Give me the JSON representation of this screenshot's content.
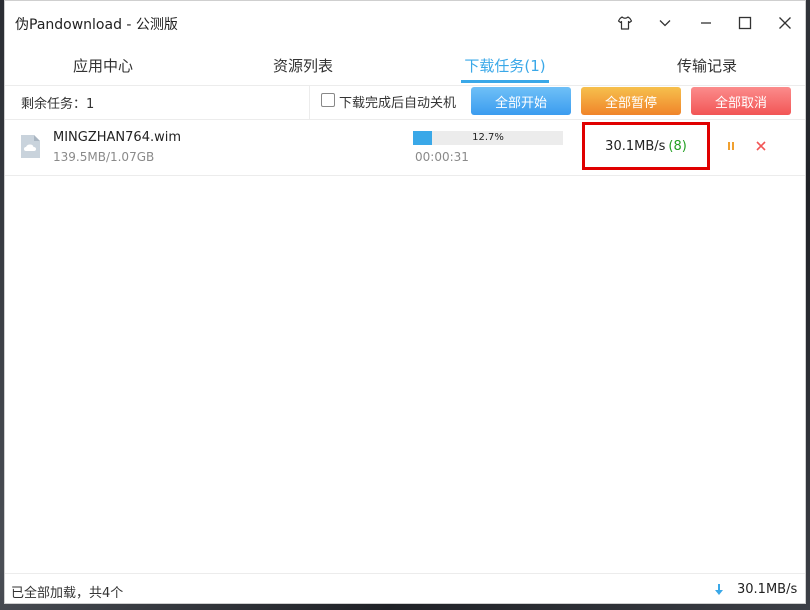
{
  "window": {
    "title": "伪Pandownload - 公测版"
  },
  "tabs": [
    {
      "label": "应用中心"
    },
    {
      "label": "资源列表"
    },
    {
      "label": "下载任务(1)"
    },
    {
      "label": "传输记录"
    }
  ],
  "toolbar": {
    "remaining": "剩余任务：1",
    "auto_shutdown_label": "下载完成后自动关机",
    "auto_shutdown_checked": false,
    "start_all": "全部开始",
    "pause_all": "全部暂停",
    "cancel_all": "全部取消"
  },
  "downloads": [
    {
      "filename": "MINGZHAN764.wim",
      "size": "139.5MB/1.07GB",
      "progress_text": "12.7%",
      "progress": 0.127,
      "elapsed": "00:00:31",
      "speed": "30.1MB/s",
      "threads": "(8)"
    }
  ],
  "statusbar": {
    "message": "已全部加载，共4个",
    "total_speed": "30.1MB/s"
  },
  "colors": {
    "accent": "#3aa8e8",
    "start_button": "#4aa8f2",
    "pause_button": "#f39a36",
    "cancel_button": "#f56a6a",
    "highlight_box": "#e00000",
    "threads": "#22a022"
  }
}
